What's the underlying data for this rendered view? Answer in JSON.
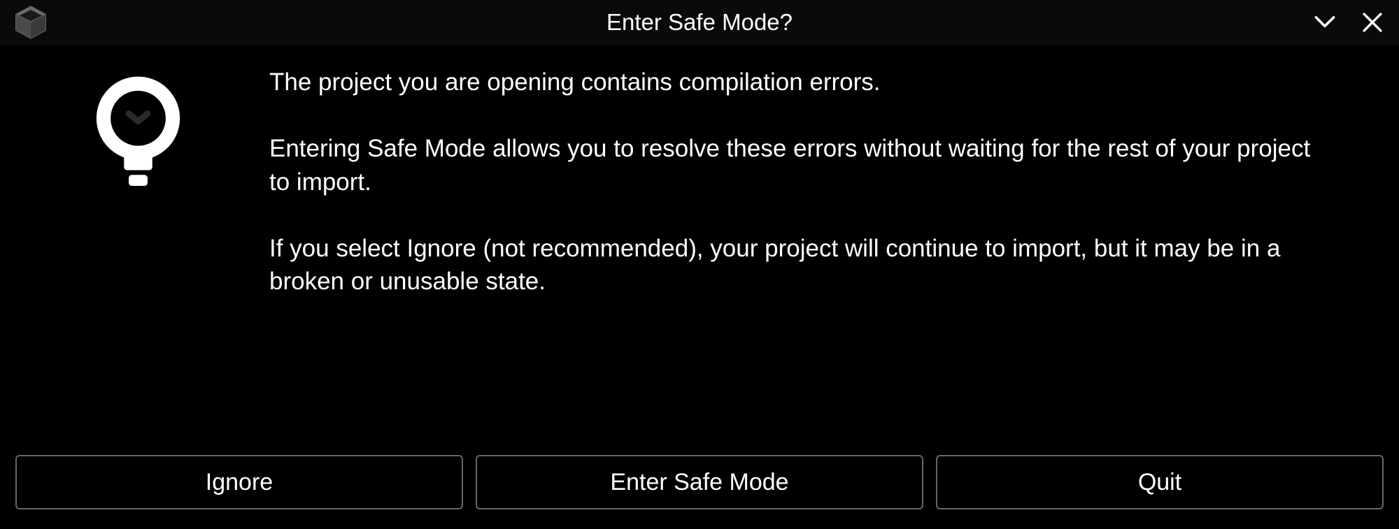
{
  "titlebar": {
    "title": "Enter Safe Mode?"
  },
  "dialog": {
    "paragraph1": "The project you are opening contains compilation errors.",
    "paragraph2": "Entering Safe Mode allows you to resolve these errors without waiting for the rest of your project to import.",
    "paragraph3": "If you select Ignore (not recommended), your project will continue to import, but it may be in a broken or unusable state."
  },
  "buttons": {
    "ignore": "Ignore",
    "enter_safe_mode": "Enter Safe Mode",
    "quit": "Quit"
  }
}
